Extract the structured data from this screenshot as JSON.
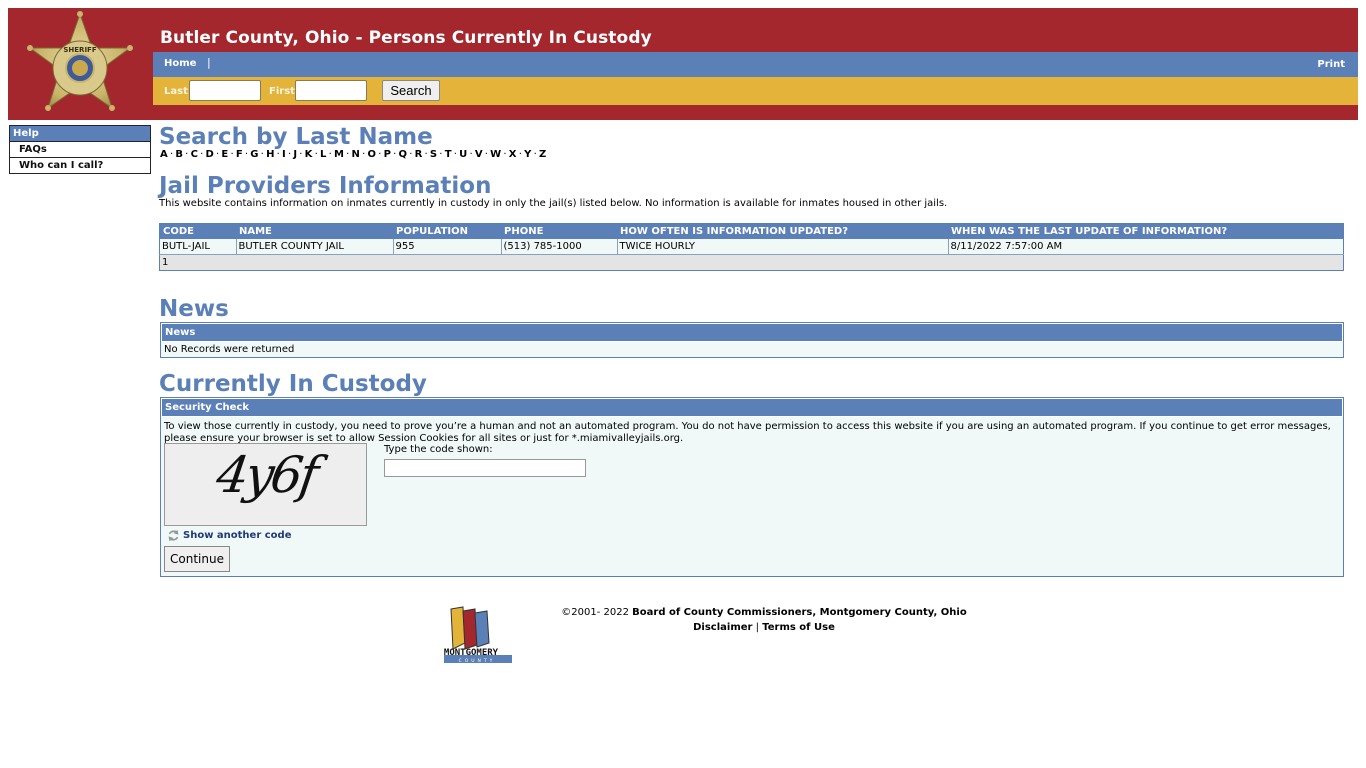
{
  "header": {
    "title": "Butler County, Ohio - Persons Currently In Custody",
    "badge_alt": "Richard K. Jones Sheriff Butler County badge",
    "colors": {
      "brand_red": "#a3272d",
      "nav_blue": "#5b7fb7",
      "search_gold": "#e4b43a"
    }
  },
  "nav": {
    "home": "Home",
    "separator": "|",
    "print": "Print"
  },
  "search": {
    "last_label": "Last",
    "last_value": "",
    "first_label": "First",
    "first_value": "",
    "button": "Search"
  },
  "sidebar": {
    "header": "Help",
    "items": [
      {
        "label": "FAQs"
      },
      {
        "label": "Who can I call?"
      }
    ]
  },
  "search_by_last_name": {
    "title": "Search by Last Name",
    "letters": [
      "A",
      "B",
      "C",
      "D",
      "E",
      "F",
      "G",
      "H",
      "I",
      "J",
      "K",
      "L",
      "M",
      "N",
      "O",
      "P",
      "Q",
      "R",
      "S",
      "T",
      "U",
      "V",
      "W",
      "X",
      "Y",
      "Z"
    ]
  },
  "jail_providers": {
    "title": "Jail Providers Information",
    "description": "This website contains information on inmates currently in custody in only the jail(s) listed below. No information is available for inmates housed in other jails.",
    "columns": [
      "CODE",
      "NAME",
      "POPULATION",
      "PHONE",
      "HOW OFTEN IS INFORMATION UPDATED?",
      "WHEN WAS THE LAST UPDATE OF INFORMATION?"
    ],
    "rows": [
      {
        "code": "BUTL-JAIL",
        "name": "BUTLER COUNTY JAIL",
        "population": "955",
        "phone": "(513) 785-1000",
        "frequency": "TWICE HOURLY",
        "last_update": "8/11/2022 7:57:00 AM"
      }
    ],
    "pager": "1"
  },
  "news": {
    "title": "News",
    "box_header": "News",
    "empty_message": "No Records were returned"
  },
  "custody": {
    "title": "Currently In Custody",
    "box_header": "Security Check",
    "message": "To view those currently in custody, you need to prove you’re a human and not an automated program. You do not have permission to access this website if you are using an automated program. If you continue to get error messages, please ensure your browser is set to allow Session Cookies for all sites or just for *.miamivalleyjails.org.",
    "captcha_text": "4y6f",
    "code_label": "Type the code shown:",
    "code_value": "",
    "refresh_label": "Show another code",
    "continue_label": "Continue"
  },
  "footer": {
    "copyright_prefix": "©2001- 2022 ",
    "copyright_org": "Board of County Commissioners, Montgomery County, Ohio",
    "disclaimer": "Disclaimer",
    "separator": "|",
    "terms": "Terms of Use",
    "logo_text": "MONTGOMERY",
    "logo_subtext": "COUNTY"
  }
}
